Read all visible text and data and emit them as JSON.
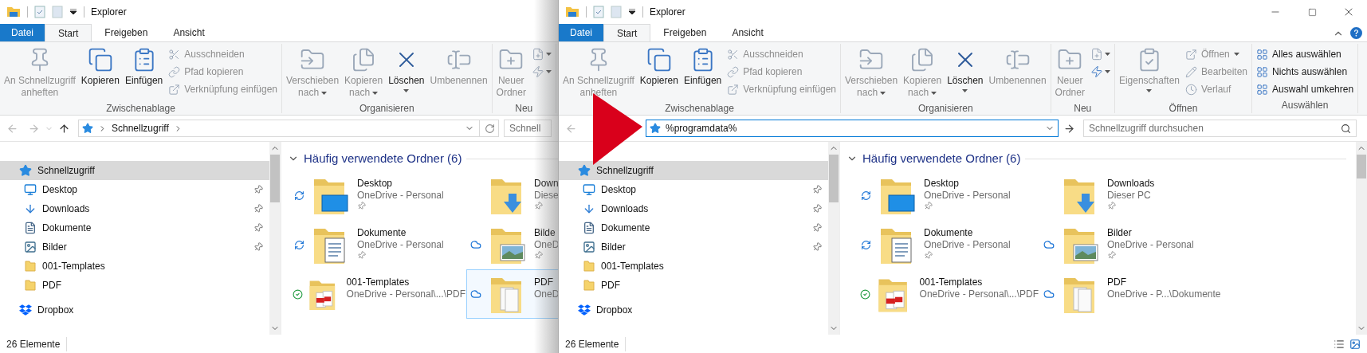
{
  "windows": [
    {
      "title": "Explorer",
      "covered_by_next": true,
      "tabs": [
        {
          "label": "Datei",
          "kind": "file",
          "selected": false
        },
        {
          "label": "Start",
          "kind": "tab",
          "selected": true
        },
        {
          "label": "Freigeben",
          "kind": "tab",
          "selected": false
        },
        {
          "label": "Ansicht",
          "kind": "tab",
          "selected": false
        }
      ],
      "ribbon": [
        {
          "label": "Zwischenablage",
          "commands": [
            {
              "kind": "large",
              "label": "An Schnellzugriff anheften",
              "disabled": true,
              "dropdown": false
            },
            {
              "kind": "large",
              "label": "Kopieren",
              "disabled": false,
              "dropdown": false
            },
            {
              "kind": "large",
              "label": "Einfügen",
              "disabled": false,
              "dropdown": false
            },
            {
              "kind": "small",
              "label": "Ausschneiden",
              "disabled": true,
              "dropdown": false
            },
            {
              "kind": "small",
              "label": "Pfad kopieren",
              "disabled": true,
              "dropdown": false
            },
            {
              "kind": "small",
              "label": "Verknüpfung einfügen",
              "disabled": true,
              "dropdown": false
            }
          ]
        },
        {
          "label": "Organisieren",
          "commands": [
            {
              "kind": "large",
              "label": "Verschieben nach",
              "disabled": true,
              "dropdown": true
            },
            {
              "kind": "large",
              "label": "Kopieren nach",
              "disabled": true,
              "dropdown": true
            },
            {
              "kind": "large",
              "label": "Löschen",
              "disabled": false,
              "dropdown": true
            },
            {
              "kind": "large",
              "label": "Umbenennen",
              "disabled": true,
              "dropdown": false
            }
          ]
        },
        {
          "label": "Neu",
          "commands": [
            {
              "kind": "large",
              "label": "Neuer Ordner",
              "disabled": true,
              "dropdown": false
            },
            {
              "kind": "icon",
              "disabled": true,
              "dropdown": true
            },
            {
              "kind": "icon",
              "disabled": true,
              "dropdown": true
            }
          ]
        }
      ],
      "address": {
        "kind": "breadcrumb",
        "value": "Schnellzugriff"
      },
      "search": {
        "placeholder": "Schnell"
      },
      "nav": [
        {
          "label": "Schnellzugriff",
          "selected": true,
          "children": [
            {
              "label": "Desktop",
              "selected": false,
              "pinned": true
            },
            {
              "label": "Downloads",
              "selected": false,
              "pinned": true
            },
            {
              "label": "Dokumente",
              "selected": false,
              "pinned": true
            },
            {
              "label": "Bilder",
              "selected": false,
              "pinned": true
            },
            {
              "label": "001-Templates",
              "selected": false,
              "pinned": false
            },
            {
              "label": "PDF",
              "selected": false,
              "pinned": false
            }
          ]
        },
        {
          "label": "Dropbox",
          "selected": false
        }
      ],
      "section": "Häufig verwendete Ordner (6)",
      "folders": [
        {
          "name": "Desktop",
          "location": "OneDrive - Personal",
          "pinned": true,
          "kind": "syncing",
          "selected": false
        },
        {
          "name": "Down",
          "location": "Diese",
          "pinned": true,
          "kind": "local",
          "selected": false
        },
        {
          "name": "Dokumente",
          "location": "OneDrive - Personal",
          "pinned": true,
          "kind": "syncing",
          "selected": false
        },
        {
          "name": "Bilde",
          "location": "OneD",
          "pinned": true,
          "kind": "cloud",
          "selected": false
        },
        {
          "name": "001-Templates",
          "location": "OneDrive - Personal\\...\\PDF",
          "pinned": false,
          "kind": "synced",
          "selected": false
        },
        {
          "name": "PDF",
          "location": "OneD",
          "pinned": false,
          "kind": "cloud",
          "selected": true
        }
      ],
      "status": "26 Elemente"
    },
    {
      "title": "Explorer",
      "covered_by_next": false,
      "tabs": [
        {
          "label": "Datei",
          "kind": "file",
          "selected": false
        },
        {
          "label": "Start",
          "kind": "tab",
          "selected": true
        },
        {
          "label": "Freigeben",
          "kind": "tab",
          "selected": false
        },
        {
          "label": "Ansicht",
          "kind": "tab",
          "selected": false
        }
      ],
      "ribbon": [
        {
          "label": "Zwischenablage",
          "commands": [
            {
              "kind": "large",
              "label": "An Schnellzugriff anheften",
              "disabled": true,
              "dropdown": false
            },
            {
              "kind": "large",
              "label": "Kopieren",
              "disabled": false,
              "dropdown": false
            },
            {
              "kind": "large",
              "label": "Einfügen",
              "disabled": false,
              "dropdown": false
            },
            {
              "kind": "small",
              "label": "Ausschneiden",
              "disabled": true,
              "dropdown": false
            },
            {
              "kind": "small",
              "label": "Pfad kopieren",
              "disabled": true,
              "dropdown": false
            },
            {
              "kind": "small",
              "label": "Verknüpfung einfügen",
              "disabled": true,
              "dropdown": false
            }
          ]
        },
        {
          "label": "Organisieren",
          "commands": [
            {
              "kind": "large",
              "label": "Verschieben nach",
              "disabled": true,
              "dropdown": true
            },
            {
              "kind": "large",
              "label": "Kopieren nach",
              "disabled": true,
              "dropdown": true
            },
            {
              "kind": "large",
              "label": "Löschen",
              "disabled": false,
              "dropdown": true
            },
            {
              "kind": "large",
              "label": "Umbenennen",
              "disabled": true,
              "dropdown": false
            }
          ]
        },
        {
          "label": "Neu",
          "commands": [
            {
              "kind": "large",
              "label": "Neuer Ordner",
              "disabled": true,
              "dropdown": false
            },
            {
              "kind": "icon",
              "disabled": true,
              "dropdown": true
            },
            {
              "kind": "icon",
              "disabled": false,
              "dropdown": true
            }
          ]
        },
        {
          "label": "Öffnen",
          "commands": [
            {
              "kind": "large",
              "label": "Eigenschaften",
              "disabled": true,
              "dropdown": true
            },
            {
              "kind": "small",
              "label": "Öffnen",
              "disabled": true,
              "dropdown": true
            },
            {
              "kind": "small",
              "label": "Bearbeiten",
              "disabled": true,
              "dropdown": false
            },
            {
              "kind": "small",
              "label": "Verlauf",
              "disabled": true,
              "dropdown": false
            }
          ]
        },
        {
          "label": "Auswählen",
          "commands": [
            {
              "kind": "small",
              "label": "Alles auswählen",
              "disabled": false,
              "dropdown": false
            },
            {
              "kind": "small",
              "label": "Nichts auswählen",
              "disabled": false,
              "dropdown": false
            },
            {
              "kind": "small",
              "label": "Auswahl umkehren",
              "disabled": false,
              "dropdown": false
            }
          ]
        }
      ],
      "address": {
        "kind": "edit",
        "value": "%programdata%"
      },
      "search": {
        "placeholder": "Schnellzugriff durchsuchen"
      },
      "nav": [
        {
          "label": "Schnellzugriff",
          "selected": true,
          "children": [
            {
              "label": "Desktop",
              "selected": false,
              "pinned": true
            },
            {
              "label": "Downloads",
              "selected": false,
              "pinned": true
            },
            {
              "label": "Dokumente",
              "selected": false,
              "pinned": true
            },
            {
              "label": "Bilder",
              "selected": false,
              "pinned": true
            },
            {
              "label": "001-Templates",
              "selected": false,
              "pinned": false
            },
            {
              "label": "PDF",
              "selected": false,
              "pinned": false
            }
          ]
        },
        {
          "label": "Dropbox",
          "selected": false
        }
      ],
      "section": "Häufig verwendete Ordner (6)",
      "folders": [
        {
          "name": "Desktop",
          "location": "OneDrive - Personal",
          "pinned": true,
          "kind": "syncing",
          "selected": false
        },
        {
          "name": "Downloads",
          "location": "Dieser PC",
          "pinned": true,
          "kind": "local",
          "selected": false
        },
        {
          "name": "Dokumente",
          "location": "OneDrive - Personal",
          "pinned": true,
          "kind": "syncing",
          "selected": false
        },
        {
          "name": "Bilder",
          "location": "OneDrive - Personal",
          "pinned": true,
          "kind": "cloud",
          "selected": false
        },
        {
          "name": "001-Templates",
          "location": "OneDrive - Personal\\...\\PDF",
          "pinned": false,
          "kind": "synced",
          "selected": false
        },
        {
          "name": "PDF",
          "location": "OneDrive - P...\\Dokumente",
          "pinned": false,
          "kind": "cloud",
          "selected": false
        }
      ],
      "status": "26 Elemente"
    }
  ]
}
